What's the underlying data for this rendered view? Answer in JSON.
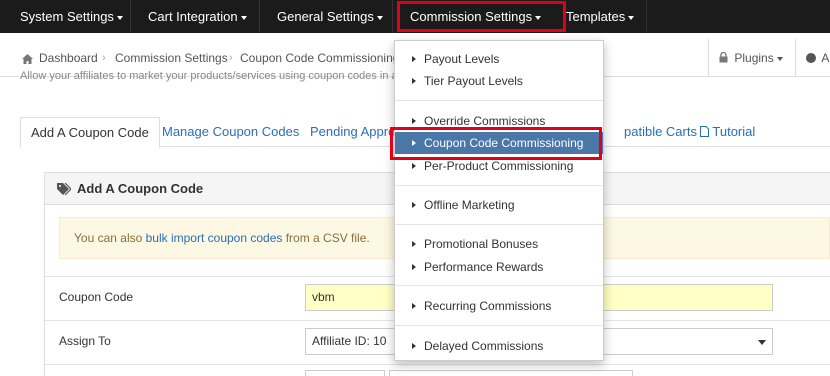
{
  "topnav": {
    "items": [
      {
        "label": "System Settings"
      },
      {
        "label": "Cart Integration"
      },
      {
        "label": "General Settings"
      },
      {
        "label": "Commission Settings"
      },
      {
        "label": "Templates"
      }
    ]
  },
  "breadcrumb": {
    "dashboard": "Dashboard",
    "commission": "Commission Settings",
    "current": "Coupon Code Commissioning",
    "plugins": "Plugins",
    "overflow": "A"
  },
  "subtext": "Allow your affiliates to market your products/services using coupon codes in add",
  "tabs": [
    {
      "label": "Add A Coupon Code"
    },
    {
      "label": "Manage Coupon Codes"
    },
    {
      "label": "Pending Appro"
    },
    {
      "label": "patible Carts"
    },
    {
      "label": "Tutorial"
    }
  ],
  "panel": {
    "title": "Add A Coupon Code",
    "notice": {
      "prefix": "You can also ",
      "link": "bulk import coupon codes",
      "suffix": " from a CSV file."
    },
    "coupon_label": "Coupon Code",
    "coupon_value": "vbm",
    "assign_label": "Assign To",
    "assign_value": "Affiliate ID: 10"
  },
  "dropdown": {
    "items": [
      {
        "label": "Payout Levels"
      },
      {
        "label": "Tier Payout Levels"
      },
      {
        "label": "Override Commissions"
      },
      {
        "label": "Coupon Code Commissioning"
      },
      {
        "label": "Per-Product Commissioning"
      },
      {
        "label": "Offline Marketing"
      },
      {
        "label": "Promotional Bonuses"
      },
      {
        "label": "Performance Rewards"
      },
      {
        "label": "Recurring Commissions"
      },
      {
        "label": "Delayed Commissions"
      }
    ],
    "active_index": 3
  },
  "colors": {
    "nav_bg": "#1b1b1b",
    "highlight_border": "#e0001a",
    "active_item_bg": "#4a77a8",
    "link": "#2a6fb5",
    "notice_bg": "#fcf8e3",
    "input_bg": "#ffffc6"
  }
}
